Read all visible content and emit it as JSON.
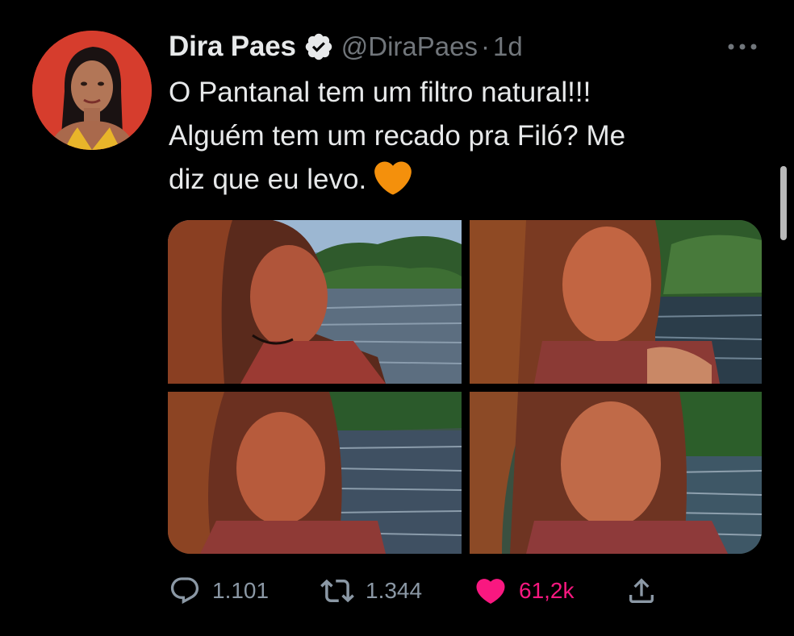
{
  "tweet": {
    "display_name": "Dira Paes",
    "verified_icon": "verified-badge-icon",
    "handle": "@DiraPaes",
    "separator": "·",
    "time": "1d",
    "text_lines": [
      "O Pantanal tem um filtro natural!!!",
      "Alguém tem um recado pra Filó? Me",
      "diz que eu levo."
    ],
    "emoji": "orange-heart-icon",
    "photos_count": 4
  },
  "actions": {
    "reply_count": "1.101",
    "retweet_count": "1.344",
    "like_count": "61,2k"
  },
  "colors": {
    "background": "#000000",
    "text": "#e7e9ea",
    "secondary": "#71767b",
    "like": "#f91880",
    "emoji_heart": "#f7931e"
  }
}
